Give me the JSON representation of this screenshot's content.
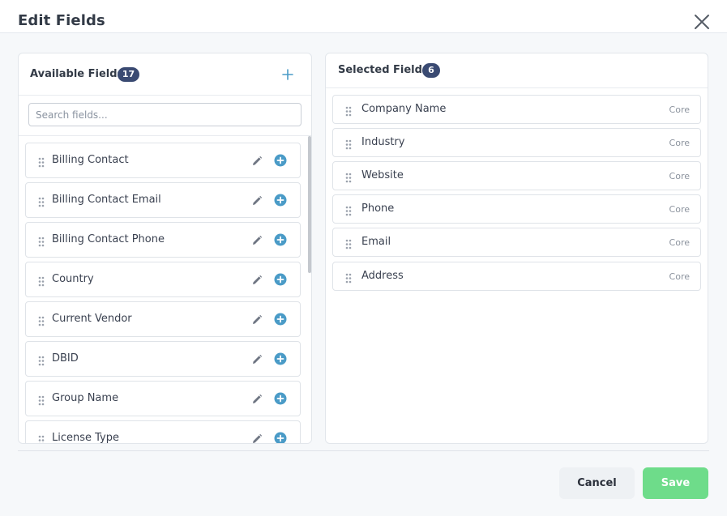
{
  "modal": {
    "title": "Edit Fields",
    "close_icon": "close-icon"
  },
  "available": {
    "title": "Available Fields",
    "count": "17",
    "add_icon": "plus-icon",
    "search_placeholder": "Search fields...",
    "search_value": "",
    "items": [
      {
        "label": "Billing Contact"
      },
      {
        "label": "Billing Contact Email"
      },
      {
        "label": "Billing Contact Phone"
      },
      {
        "label": "Country"
      },
      {
        "label": "Current Vendor"
      },
      {
        "label": "DBID"
      },
      {
        "label": "Group Name"
      },
      {
        "label": "License Type"
      }
    ]
  },
  "selected": {
    "title": "Selected Fields",
    "count": "6",
    "items": [
      {
        "label": "Company Name",
        "tag": "Core"
      },
      {
        "label": "Industry",
        "tag": "Core"
      },
      {
        "label": "Website",
        "tag": "Core"
      },
      {
        "label": "Phone",
        "tag": "Core"
      },
      {
        "label": "Email",
        "tag": "Core"
      },
      {
        "label": "Address",
        "tag": "Core"
      }
    ]
  },
  "footer": {
    "cancel_label": "Cancel",
    "save_label": "Save"
  },
  "colors": {
    "badge": "#3a4a72",
    "add_accent": "#4a9bc7",
    "save_button": "#6edc8a",
    "cancel_button": "#eef1f4"
  }
}
